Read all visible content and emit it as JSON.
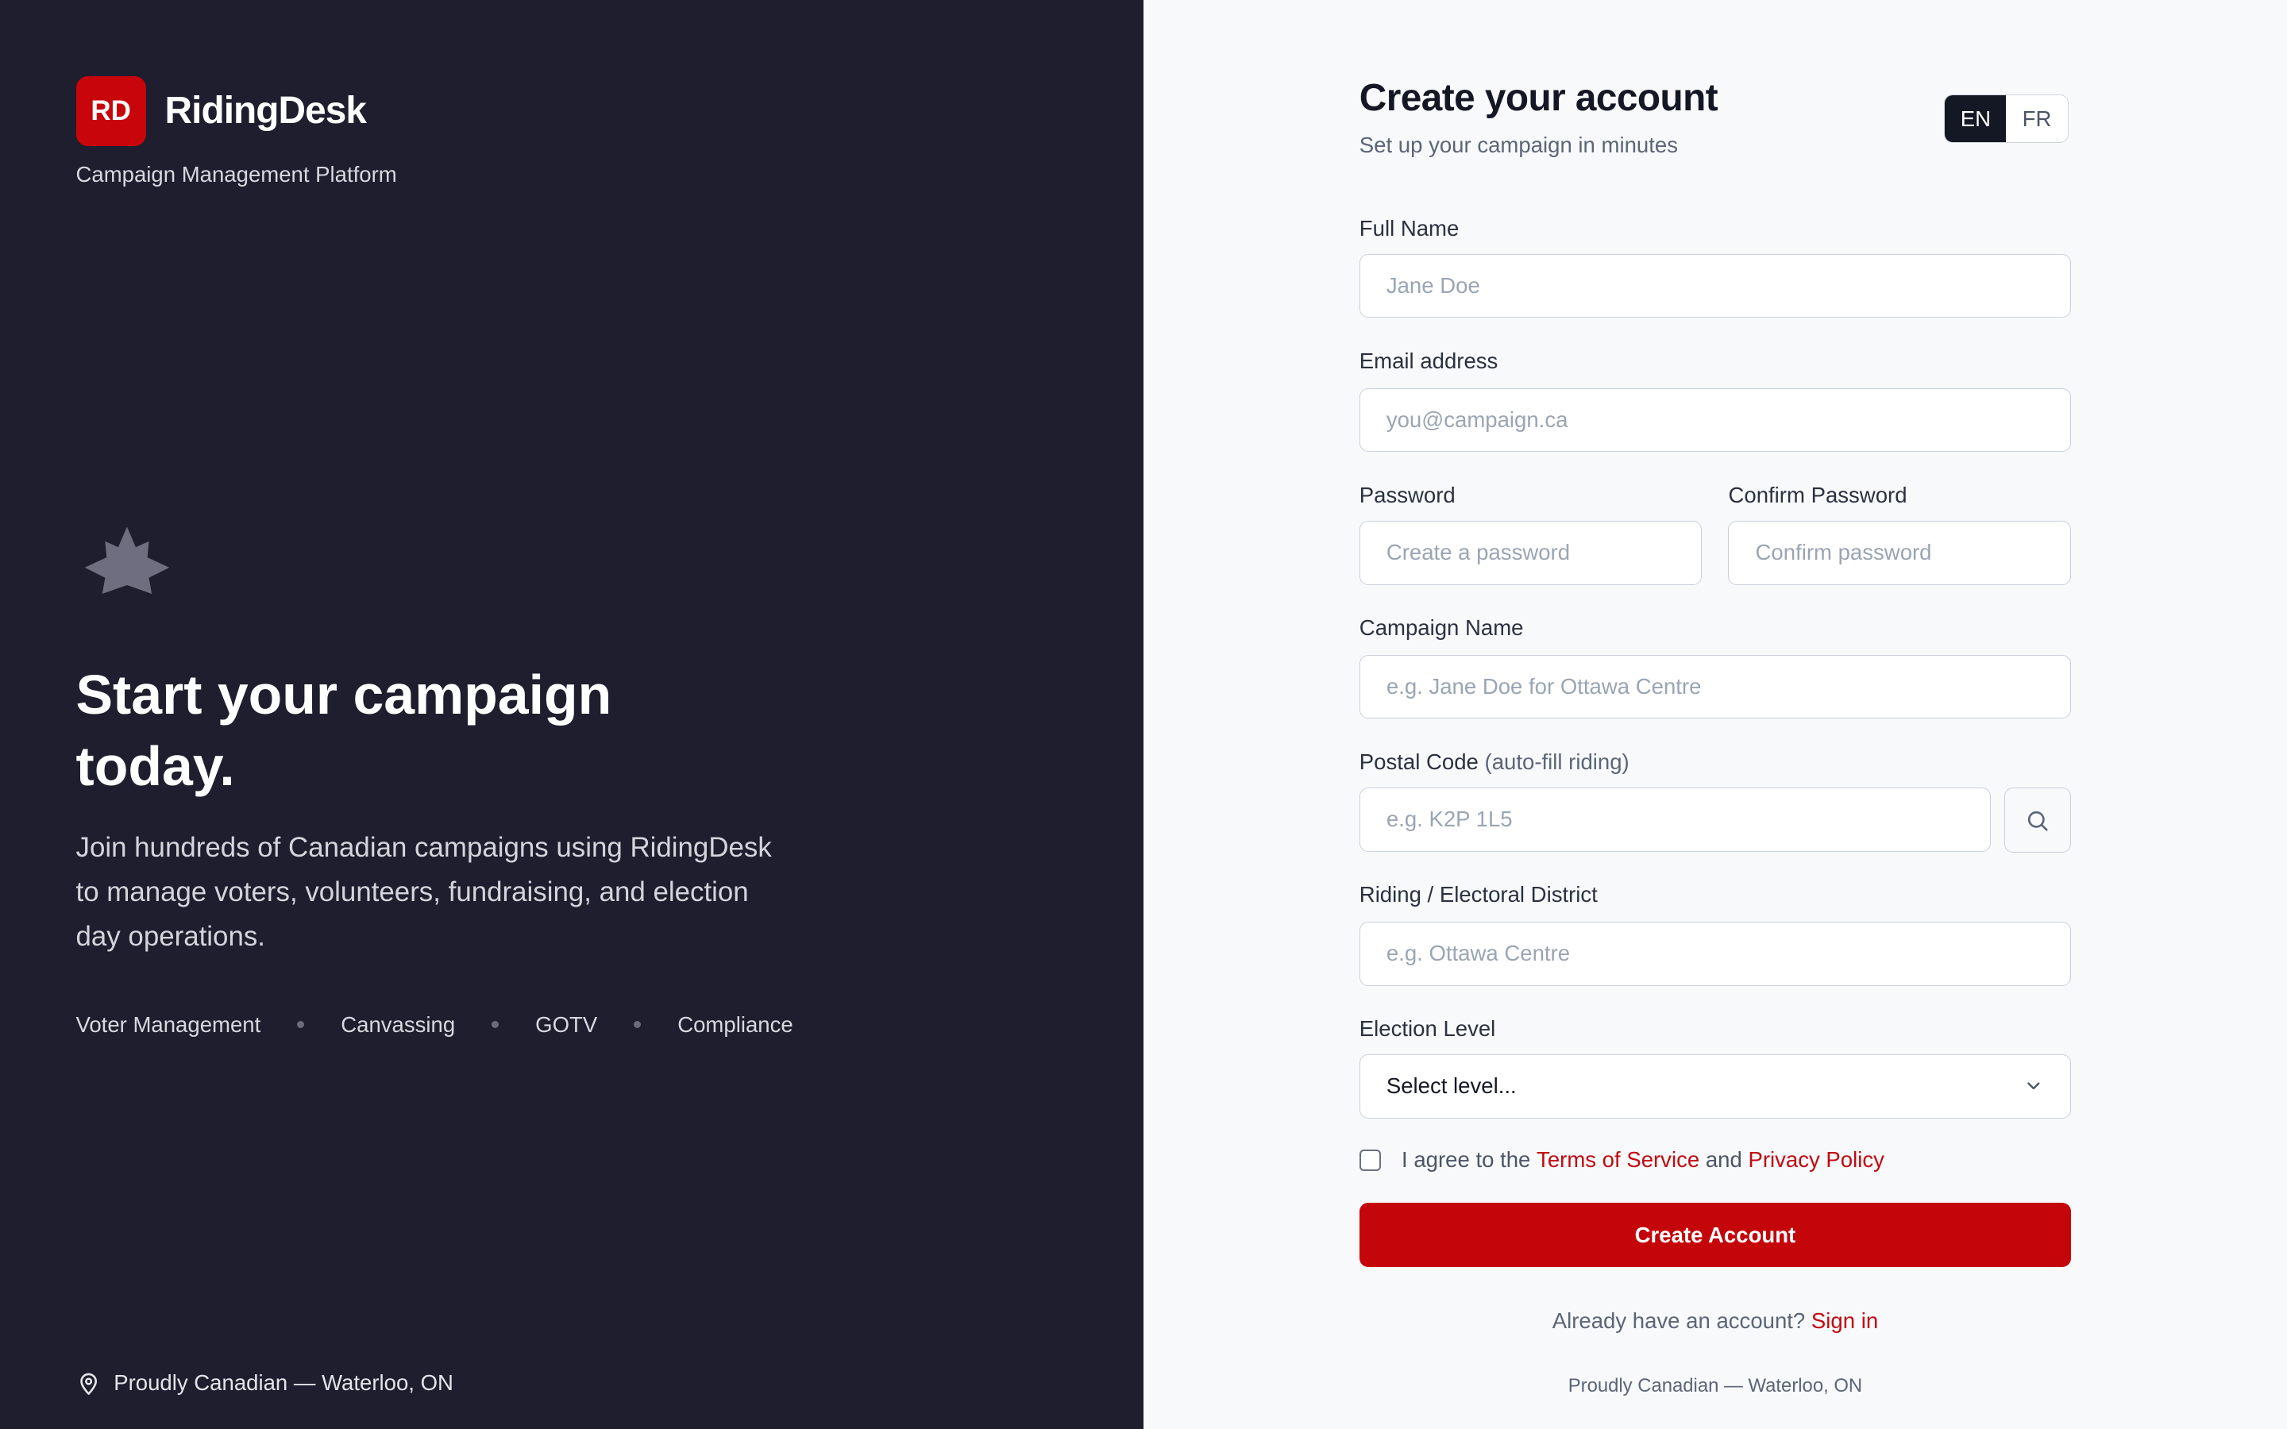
{
  "brand": {
    "logo_text": "RD",
    "name": "RidingDesk",
    "tagline": "Campaign Management Platform"
  },
  "hero": {
    "icon": "maple-leaf-icon",
    "title": "Start your campaign today.",
    "description": "Join hundreds of Canadian campaigns using RidingDesk to manage voters, volunteers, fundraising, and election day operations.",
    "features": [
      "Voter Management",
      "Canvassing",
      "GOTV",
      "Compliance"
    ]
  },
  "left_footer": {
    "icon": "location-pin-icon",
    "text": "Proudly Canadian — Waterloo, ON"
  },
  "form": {
    "title": "Create your account",
    "subtitle": "Set up your campaign in minutes",
    "languages": [
      "EN",
      "FR"
    ],
    "selected_language": "EN",
    "full_name": {
      "label": "Full Name",
      "placeholder": "Jane Doe",
      "value": ""
    },
    "email": {
      "label": "Email address",
      "placeholder": "you@campaign.ca",
      "value": ""
    },
    "password": {
      "label": "Password",
      "placeholder": "Create a password",
      "value": ""
    },
    "confirm_password": {
      "label": "Confirm Password",
      "placeholder": "Confirm password",
      "value": ""
    },
    "campaign_name": {
      "label": "Campaign Name",
      "placeholder": "e.g. Jane Doe for Ottawa Centre",
      "value": ""
    },
    "postal_code": {
      "label": "Postal Code",
      "hint": "(auto-fill riding)",
      "placeholder": "e.g. K2P 1L5",
      "value": "",
      "button_icon": "search-icon"
    },
    "riding": {
      "label": "Riding / Electoral District",
      "placeholder": "e.g. Ottawa Centre",
      "value": ""
    },
    "election_level": {
      "label": "Election Level",
      "selected": "Select level...",
      "dropdown_icon": "chevron-down-icon"
    },
    "agree": {
      "checked": false,
      "prefix": "I agree to the",
      "terms_link": "Terms of Service",
      "conjunction": "and",
      "privacy_link": "Privacy Policy"
    },
    "submit_label": "Create Account",
    "signin_prompt": "Already have an account?",
    "signin_link": "Sign in",
    "footer": "Proudly Canadian — Waterloo, ON"
  },
  "colors": {
    "panel_dark": "#1e1e2e",
    "accent_red": "#c4050a",
    "link_red": "#c00a10",
    "panel_light": "#f8f9fb"
  }
}
